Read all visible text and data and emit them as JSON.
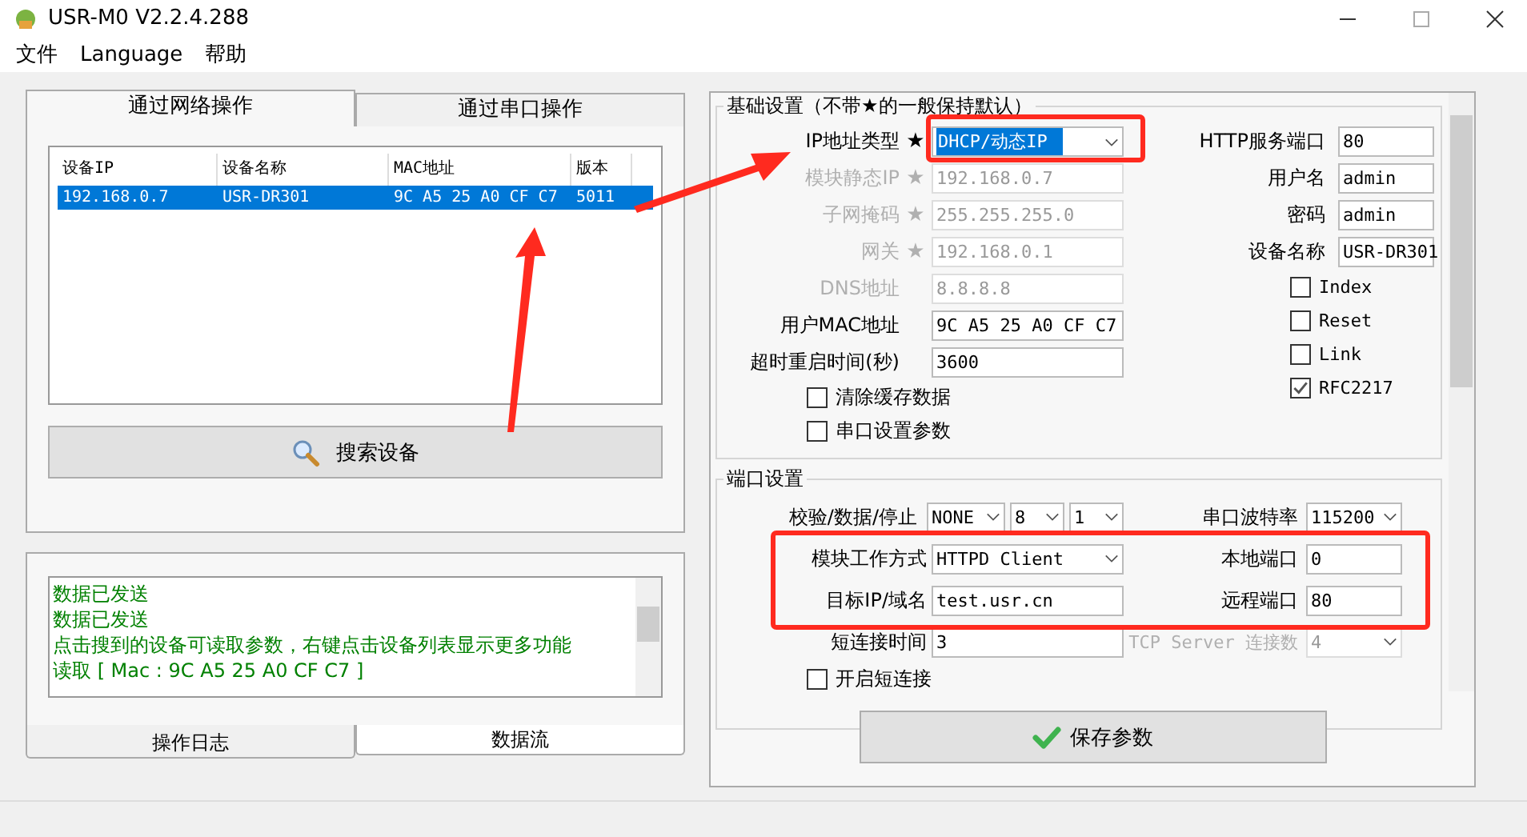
{
  "window": {
    "title": "USR-M0 V2.2.4.288"
  },
  "menu": [
    "文件",
    "Language",
    "帮助"
  ],
  "device_tabs": [
    {
      "label": "通过网络操作",
      "selected": true
    },
    {
      "label": "通过串口操作",
      "selected": false
    }
  ],
  "device_table": {
    "columns": [
      "设备IP",
      "设备名称",
      "MAC地址",
      "版本"
    ],
    "rows": [
      {
        "cells": [
          "192.168.0.7",
          "USR-DR301",
          "9C A5 25 A0 CF C7",
          "5011"
        ],
        "selected": true
      }
    ]
  },
  "search_button": "搜索设备",
  "log": {
    "lines": [
      "数据已发送",
      "数据已发送",
      "点击搜到的设备可读取参数，右键点击设备列表显示更多功能",
      "读取 [ Mac : 9C A5 25 A0 CF C7 ]"
    ]
  },
  "log_tabs": [
    {
      "label": "操作日志",
      "selected": true
    },
    {
      "label": "数据流",
      "selected": false
    }
  ],
  "basic_settings": {
    "title": "基础设置（不带★的一般保持默认）",
    "fields": [
      {
        "label": "IP地址类型",
        "marker": "★",
        "value": "DHCP/动态IP",
        "kind": "select",
        "disabled": false,
        "highlighted": true
      },
      {
        "label": "模块静态IP",
        "marker": "★",
        "value": "192.168.0.7",
        "kind": "text",
        "disabled": true,
        "highlighted": false
      },
      {
        "label": "子网掩码",
        "marker": "★",
        "value": "255.255.255.0",
        "kind": "text",
        "disabled": true,
        "highlighted": false
      },
      {
        "label": "网关",
        "marker": "★",
        "value": "192.168.0.1",
        "kind": "text",
        "disabled": true,
        "highlighted": false
      },
      {
        "label": "DNS地址",
        "value": "8.8.8.8",
        "kind": "text",
        "disabled": true,
        "highlighted": false
      },
      {
        "label": "用户MAC地址",
        "value": "9C A5 25 A0 CF C7",
        "kind": "text",
        "disabled": false,
        "highlighted": false
      },
      {
        "label": "超时重启时间(秒)",
        "value": "3600",
        "kind": "text",
        "disabled": false,
        "highlighted": false
      }
    ],
    "checkboxes": [
      {
        "label": "清除缓存数据",
        "checked": false
      },
      {
        "label": "串口设置参数",
        "checked": false
      }
    ],
    "side_fields": [
      {
        "label": "HTTP服务端口",
        "value": "80"
      },
      {
        "label": "用户名",
        "value": "admin"
      },
      {
        "label": "密码",
        "value": "admin"
      },
      {
        "label": "设备名称",
        "value": "USR-DR301"
      }
    ],
    "side_checkboxes": [
      {
        "label": "Index",
        "checked": false
      },
      {
        "label": "Reset",
        "checked": false
      },
      {
        "label": "Link",
        "checked": false
      },
      {
        "label": "RFC2217",
        "checked": true
      }
    ]
  },
  "port_settings": {
    "title": "端口设置",
    "rows": [
      {
        "left": {
          "label": "校验/数据/停止",
          "kind": "select",
          "values": [
            "NONE",
            "8",
            "1"
          ]
        },
        "right": {
          "label": "串口波特率",
          "kind": "select",
          "values": [
            "115200"
          ],
          "disabled": false
        }
      },
      {
        "left": {
          "label": "模块工作方式",
          "kind": "select",
          "values": [
            "HTTPD Client"
          ]
        },
        "right": {
          "label": "本地端口",
          "kind": "text",
          "values": [
            "0"
          ],
          "disabled": false
        }
      },
      {
        "left": {
          "label": "目标IP/域名",
          "kind": "text",
          "values": [
            "test.usr.cn"
          ]
        },
        "right": {
          "label": "远程端口",
          "kind": "text",
          "values": [
            "80"
          ],
          "disabled": false
        }
      },
      {
        "left": {
          "label": "短连接时间",
          "kind": "text",
          "values": [
            "3"
          ]
        },
        "right": {
          "label": "TCP Server 连接数",
          "kind": "select",
          "values": [
            "4"
          ],
          "disabled": true
        }
      }
    ],
    "checkboxes": [
      {
        "label": "开启短连接",
        "checked": false
      }
    ]
  },
  "save_button": "保存参数"
}
